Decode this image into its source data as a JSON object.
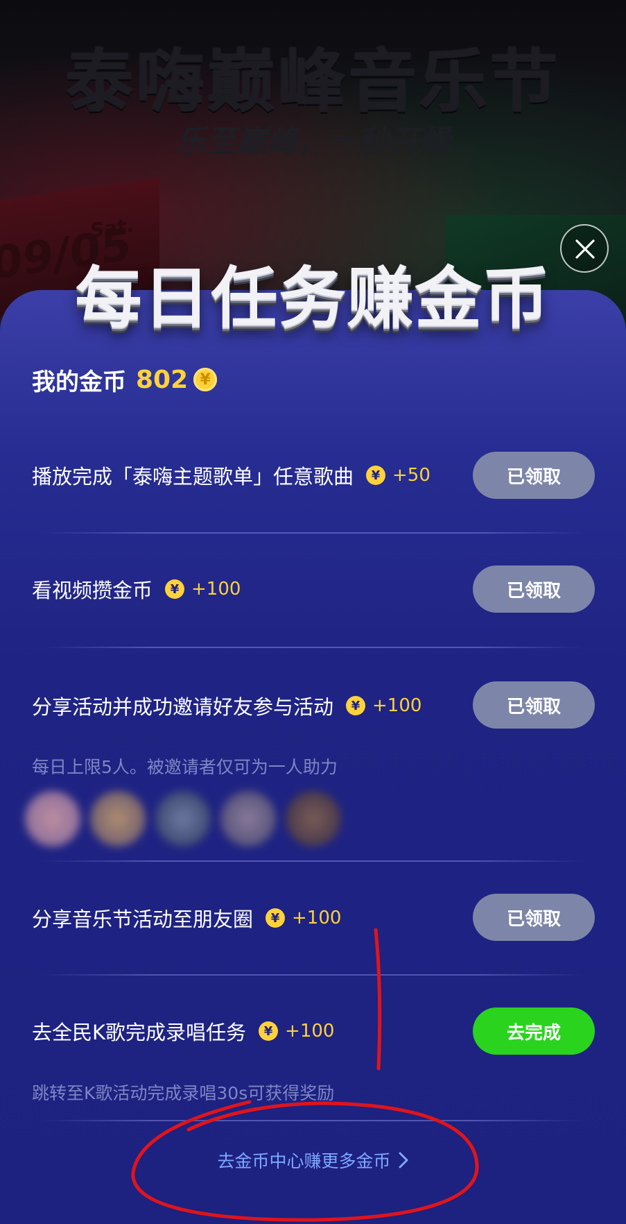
{
  "background": {
    "title": "泰嗨巅峰音乐节",
    "subtitle": "乐至巅峰，一秒开燥",
    "date": "09/05",
    "day": "Sat."
  },
  "dialog": {
    "title": "每日任务赚金币",
    "close_icon": "close-icon"
  },
  "coins": {
    "label": "我的金币",
    "value": "802",
    "icon": "coin-icon",
    "coin_glyph": "¥"
  },
  "tasks": [
    {
      "title": "播放完成「泰嗨主题歌单」任意歌曲",
      "reward": "+50",
      "button": "已领取",
      "status": "claimed"
    },
    {
      "title": "看视频攒金币",
      "reward": "+100",
      "button": "已领取",
      "status": "claimed"
    },
    {
      "title": "分享活动并成功邀请好友参与活动",
      "reward": "+100",
      "button": "已领取",
      "status": "claimed",
      "note": "每日上限5人。被邀请者仅可为一人助力"
    },
    {
      "title": "分享音乐节活动至朋友圈",
      "reward": "+100",
      "button": "已领取",
      "status": "claimed"
    },
    {
      "title": "去全民K歌完成录唱任务",
      "reward": "+100",
      "button": "去完成",
      "status": "todo",
      "note": "跳转至K歌活动完成录唱30s可获得奖励"
    }
  ],
  "footer": {
    "more_link": "去金币中心赚更多金币",
    "chevron": "›"
  },
  "colors": {
    "panel": "#1f2383",
    "coin": "#ffd23a",
    "claimed_button": "#7d86a8",
    "go_button": "#2ad41e",
    "link": "#7fa8ff",
    "annotation": "#e0141b"
  }
}
